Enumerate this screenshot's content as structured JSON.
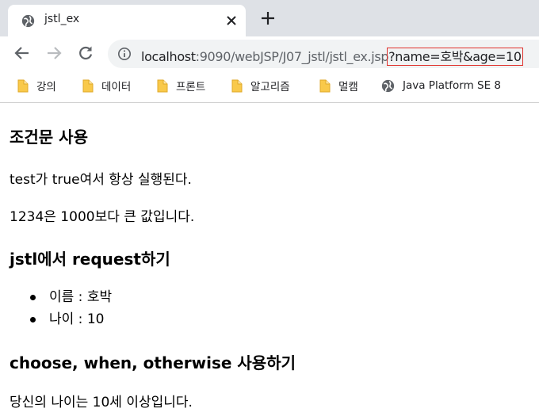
{
  "tab": {
    "title": "jstl_ex"
  },
  "toolbar": {
    "url_host": "localhost",
    "url_path": ":9090/webJSP/J07_jstl/jstl_ex.jsp",
    "url_query": "?name=호박&age=10"
  },
  "bookmarks": [
    {
      "label": "강의",
      "icon": "folder-icon"
    },
    {
      "label": "데이터",
      "icon": "folder-icon"
    },
    {
      "label": "프론트",
      "icon": "folder-icon"
    },
    {
      "label": "알고리즘",
      "icon": "folder-icon"
    },
    {
      "label": "멀캠",
      "icon": "folder-icon"
    },
    {
      "label": "Java Platform SE 8",
      "icon": "globe-icon"
    }
  ],
  "page": {
    "heading_conditional": "조건문 사용",
    "test_true_text": "test가 true여서 항상 실행된다.",
    "compare_text": "1234은 1000보다 큰 값입니다.",
    "heading_request": "jstl에서 request하기",
    "param_items": [
      "이름 : 호박",
      "나이 : 10"
    ],
    "heading_choose": "choose, when, otherwise 사용하기",
    "choose_result": "당신의 나이는 10세 이상입니다."
  },
  "colors": {
    "tabstrip": "#dee1e6",
    "omnibox": "#f1f3f4",
    "highlight_box": "#e0312c",
    "folder": "#f9c94a"
  }
}
